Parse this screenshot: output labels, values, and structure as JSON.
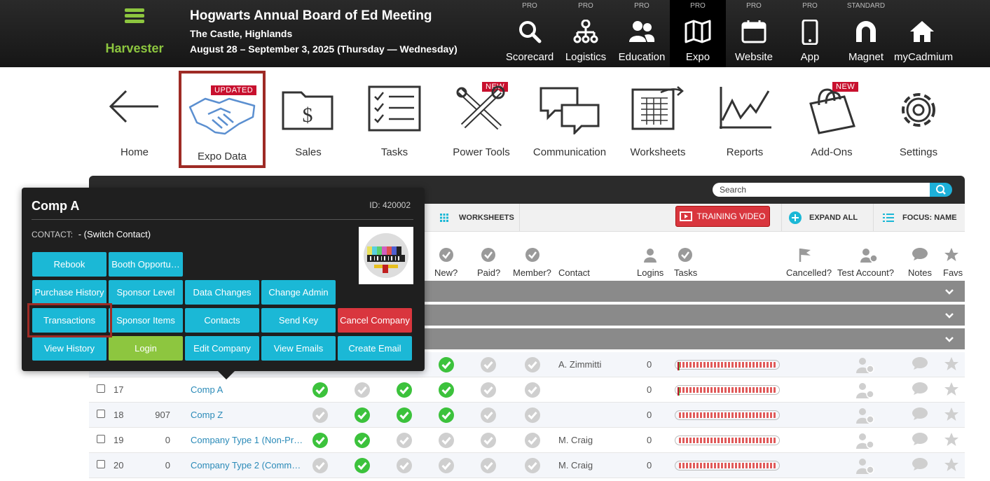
{
  "brand": {
    "name": "Harvester",
    "menu_icon": "hamburger-icon",
    "color": "#8dc63f"
  },
  "event": {
    "title": "Hogwarts Annual Board of Ed Meeting",
    "location": "The Castle, Highlands",
    "dates": "August 28 – September 3, 2025 (Thursday — Wednesday)"
  },
  "nav": [
    {
      "tier": "PRO",
      "label": "Scorecard",
      "icon": "search-icon"
    },
    {
      "tier": "PRO",
      "label": "Logistics",
      "icon": "org-chart-icon"
    },
    {
      "tier": "PRO",
      "label": "Education",
      "icon": "people-icon"
    },
    {
      "tier": "PRO",
      "label": "Expo",
      "icon": "map-icon",
      "active": true
    },
    {
      "tier": "PRO",
      "label": "Website",
      "icon": "calendar-icon"
    },
    {
      "tier": "PRO",
      "label": "App",
      "icon": "phone-icon"
    },
    {
      "tier": "STANDARD",
      "label": "Magnet",
      "icon": "magnet-icon"
    },
    {
      "tier": "",
      "label": "myCadmium",
      "icon": "home-icon"
    }
  ],
  "modules": [
    {
      "label": "Home",
      "icon": "back-arrow-icon"
    },
    {
      "label": "Expo Data",
      "icon": "handshake-icon",
      "badge": "UPDATED",
      "selected": true
    },
    {
      "label": "Sales",
      "icon": "money-folder-icon"
    },
    {
      "label": "Tasks",
      "icon": "checklist-icon"
    },
    {
      "label": "Power Tools",
      "icon": "tools-icon",
      "badge": "NEW"
    },
    {
      "label": "Communication",
      "icon": "chat-bubbles-icon"
    },
    {
      "label": "Worksheets",
      "icon": "spreadsheet-icon"
    },
    {
      "label": "Reports",
      "icon": "line-chart-icon"
    },
    {
      "label": "Add-Ons",
      "icon": "shopping-bag-icon",
      "badge": "NEW"
    },
    {
      "label": "Settings",
      "icon": "gear-icon"
    }
  ],
  "grid": {
    "search_placeholder": "Search",
    "toolbar": {
      "worksheets": "WORKSHEETS",
      "training_video": "TRAINING VIDEO",
      "expand_all": "EXPAND ALL",
      "focus": "FOCUS: NAME"
    },
    "columns": [
      "New?",
      "Paid?",
      "Member?",
      "Contact",
      "Logins",
      "Tasks",
      "Cancelled?",
      "Test Account?",
      "Notes",
      "Favs"
    ],
    "rows": [
      {
        "num": "",
        "booth": "",
        "name": "",
        "c1": "",
        "c2": "",
        "c3": "",
        "new": "green",
        "paid": "gray",
        "member": "gray",
        "contact": "A. Zimmitti",
        "logins": "0",
        "progress": 0.02
      },
      {
        "num": "17",
        "booth": "",
        "name": "Comp A",
        "c1": "green",
        "c2": "gray",
        "c3": "green",
        "new": "green",
        "paid": "gray",
        "member": "gray",
        "contact": "",
        "logins": "0",
        "progress": 0.02
      },
      {
        "num": "18",
        "booth": "907",
        "name": "Comp Z",
        "c1": "gray",
        "c2": "green",
        "c3": "green",
        "new": "green",
        "paid": "gray",
        "member": "gray",
        "contact": "",
        "logins": "0",
        "progress": 0
      },
      {
        "num": "19",
        "booth": "0",
        "name": "Company Type 1 (Non-Pr…",
        "c1": "green",
        "c2": "green",
        "c3": "gray",
        "new": "gray",
        "paid": "gray",
        "member": "gray",
        "contact": "M. Craig",
        "logins": "0",
        "progress": 0
      },
      {
        "num": "20",
        "booth": "0",
        "name": "Company Type 2 (Comm…",
        "c1": "gray",
        "c2": "green",
        "c3": "gray",
        "new": "gray",
        "paid": "gray",
        "member": "gray",
        "contact": "M. Craig",
        "logins": "0",
        "progress": 0
      }
    ]
  },
  "popover": {
    "company": "Comp A",
    "id_label": "ID: 420002",
    "contact_key": "CONTACT:",
    "contact_value": "- (Switch Contact)",
    "buttons": [
      [
        "Rebook",
        "Booth Opportu…",
        "",
        "",
        ""
      ],
      [
        "Purchase History",
        "Sponsor Level",
        "Data Changes",
        "Change Admin",
        ""
      ],
      [
        "Transactions",
        "Sponsor Items",
        "Contacts",
        "Send Key",
        "Cancel Company"
      ],
      [
        "View History",
        "Login",
        "Edit Company",
        "View Emails",
        "Create Email"
      ]
    ]
  },
  "colors": {
    "accent": "#1bb8d6",
    "danger": "#d9363e",
    "success": "#3cc23c",
    "highlight": "#9e2b25"
  }
}
